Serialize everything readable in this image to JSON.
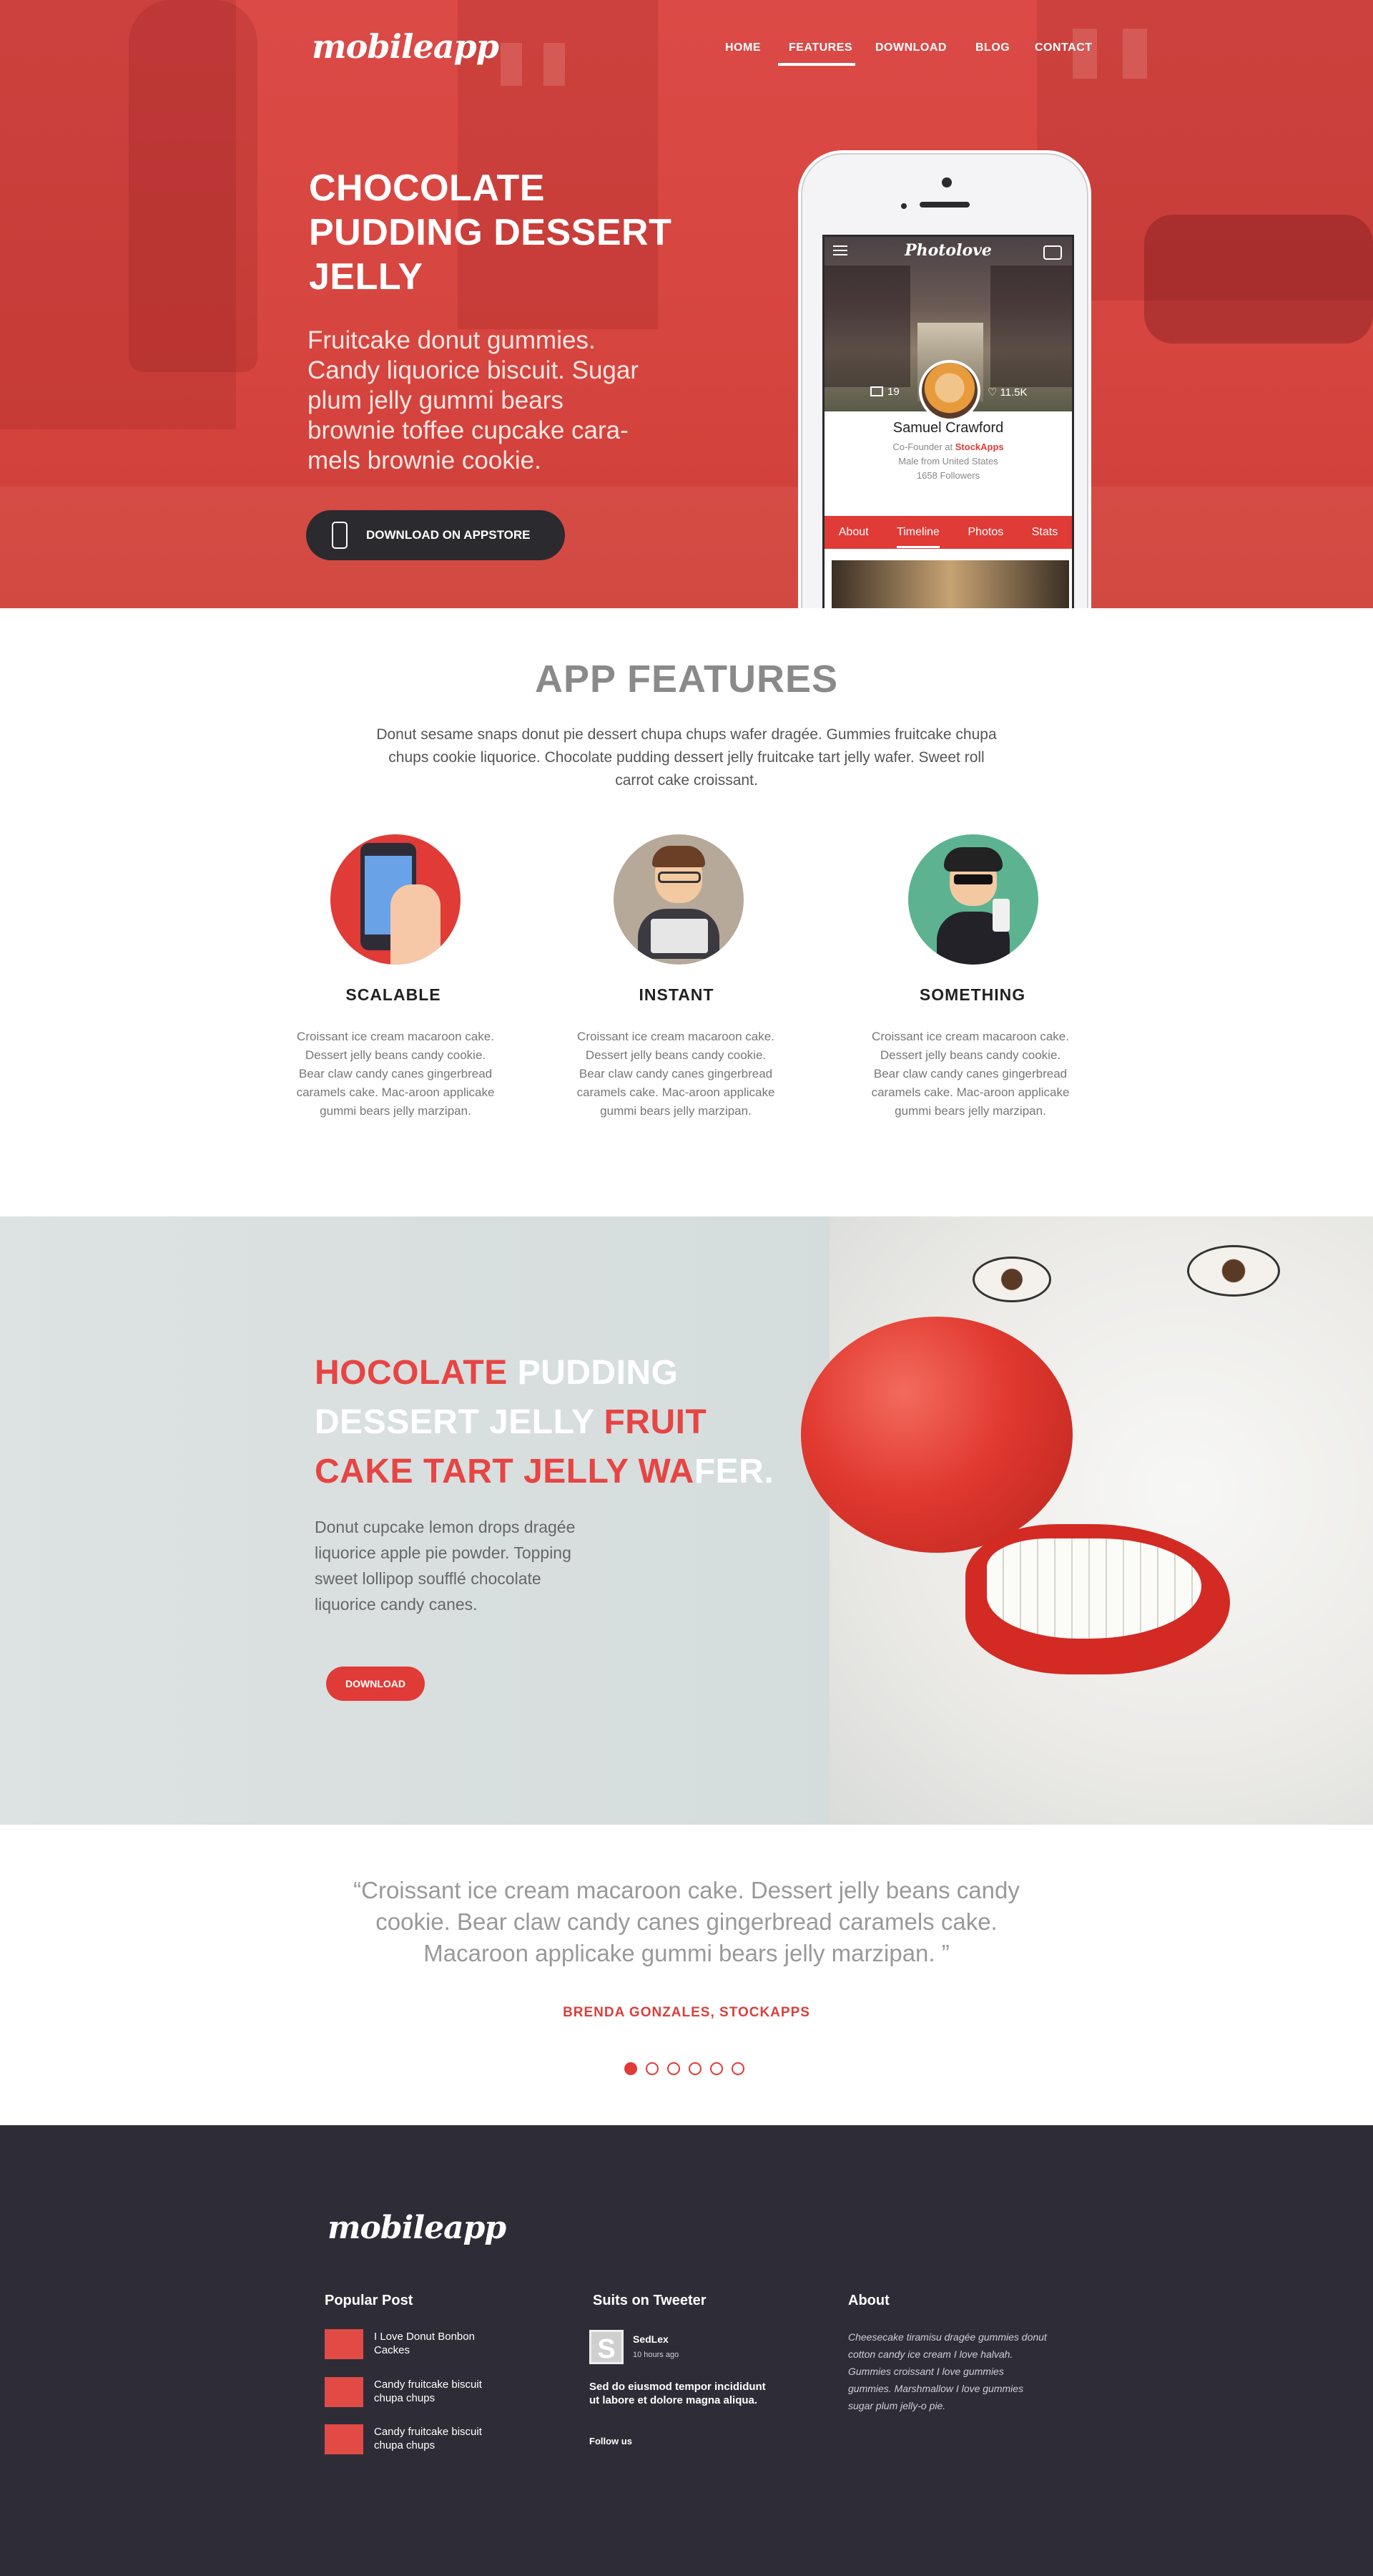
{
  "brand": {
    "logo": "mobileapp"
  },
  "nav": {
    "items": [
      "HOME",
      "FEATURES",
      "DOWNLOAD",
      "BLOG",
      "CONTACT"
    ],
    "active": "FEATURES"
  },
  "hero": {
    "title": "CHOCOLATE PUDDING DESSERT JELLY",
    "description": "Fruitcake donut gummies. Candy liquorice biscuit. Sugar plum jelly gummi bears brownie toffee cupcake cara-mels brownie cookie.",
    "cta": "DOWNLOAD ON APPSTORE"
  },
  "phone_app": {
    "app_name": "Photolove",
    "photos_count": "19",
    "likes_count": "11.5K",
    "profile_name": "Samuel Crawford",
    "role_prefix": "Co-Founder at ",
    "company": "StockApps",
    "location": "Male from United States",
    "followers": "1658 Followers",
    "tabs": [
      "About",
      "Timeline",
      "Photos",
      "Stats"
    ]
  },
  "features": {
    "title": "APP FEATURES",
    "description": "Donut sesame snaps donut pie dessert chupa chups wafer dragée. Gummies fruitcake chupa chups cookie liquorice. Chocolate pudding dessert jelly fruitcake tart jelly wafer. Sweet roll carrot cake croissant.",
    "items": [
      {
        "title": "SCALABLE",
        "text": "Croissant ice cream macaroon cake. Dessert jelly beans candy cookie. Bear claw candy canes gingerbread caramels cake. Mac-aroon applicake gummi bears jelly marzipan."
      },
      {
        "title": "INSTANT",
        "text": "Croissant ice cream macaroon cake. Dessert jelly beans candy cookie. Bear claw candy canes gingerbread caramels cake. Mac-aroon applicake gummi bears jelly marzipan."
      },
      {
        "title": "SOMETHING",
        "text": "Croissant ice cream macaroon cake. Dessert jelly beans candy cookie. Bear claw candy canes gingerbread caramels cake. Mac-aroon applicake gummi bears jelly marzipan."
      }
    ]
  },
  "promo": {
    "title_parts": [
      "HOCOLATE ",
      "PUDDING ",
      "DESSERT JELLY ",
      "FRUIT ",
      "CAKE TART JELLY WA",
      "FER."
    ],
    "description": "Donut cupcake lemon drops dragée liquorice apple pie powder. Topping sweet lollipop soufflé chocolate liquorice candy canes.",
    "cta": "DOWNLOAD"
  },
  "testimonial": {
    "quote": "“Croissant ice cream macaroon cake. Dessert jelly beans candy cookie. Bear claw candy canes gingerbread caramels cake. Macaroon applicake gummi bears jelly marzipan. ”",
    "author": "BRENDA GONZALES, STOCKAPPS",
    "slides": 6,
    "active_slide": 1
  },
  "footer": {
    "logo": "mobileapp",
    "popular_post": {
      "heading": "Popular Post",
      "posts": [
        "I Love Donut Bonbon Cackes",
        "Candy fruitcake biscuit chupa chups",
        "Candy fruitcake biscuit chupa chups"
      ]
    },
    "tweeter": {
      "heading": "Suits on Tweeter",
      "user": "SedLex",
      "time": "10 hours ago",
      "tweet": "Sed do eiusmod tempor incididunt ut labore et dolore magna aliqua.",
      "follow": "Follow us"
    },
    "about": {
      "heading": "About",
      "text": "Cheesecake tiramisu dragée gummies donut cotton candy ice cream I love halvah. Gummies croissant I love gummies gummies. Marshmallow I love gummies sugar plum jelly-o pie."
    }
  },
  "colors": {
    "accent": "#e03b37",
    "dark": "#2e2d37",
    "text_gray": "#8a8a8a"
  }
}
